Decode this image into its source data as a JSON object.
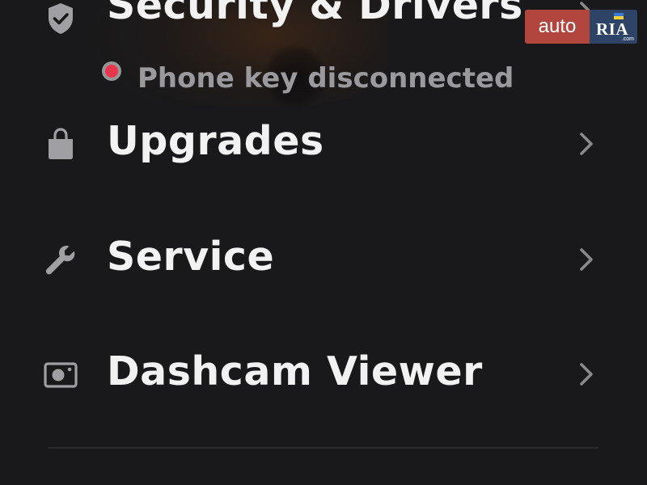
{
  "menu": {
    "security": {
      "label": "Security & Drivers",
      "status_text": "Phone key disconnected",
      "status_color": "#e8374d",
      "icon": "shield-check-icon"
    },
    "items": [
      {
        "label": "Upgrades",
        "icon": "shopping-bag-icon"
      },
      {
        "label": "Service",
        "icon": "wrench-icon"
      },
      {
        "label": "Dashcam Viewer",
        "icon": "dashcam-icon"
      }
    ]
  },
  "watermark": {
    "left_text": "auto",
    "right_text": "RIA",
    "suffix": ".com",
    "left_color": "#b3453f",
    "right_color": "#2d4466"
  },
  "colors": {
    "background": "#19191b",
    "text": "#f2f2f2",
    "muted_text": "#9a9a9e",
    "icon": "#a0a0a4",
    "chevron": "#8a8a8e"
  }
}
